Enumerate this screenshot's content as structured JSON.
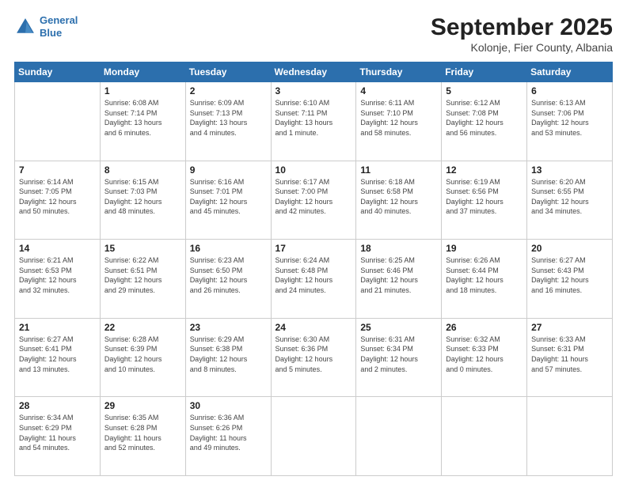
{
  "header": {
    "logo_line1": "General",
    "logo_line2": "Blue",
    "title": "September 2025",
    "subtitle": "Kolonje, Fier County, Albania"
  },
  "days_of_week": [
    "Sunday",
    "Monday",
    "Tuesday",
    "Wednesday",
    "Thursday",
    "Friday",
    "Saturday"
  ],
  "weeks": [
    [
      {
        "num": "",
        "info": ""
      },
      {
        "num": "1",
        "info": "Sunrise: 6:08 AM\nSunset: 7:14 PM\nDaylight: 13 hours\nand 6 minutes."
      },
      {
        "num": "2",
        "info": "Sunrise: 6:09 AM\nSunset: 7:13 PM\nDaylight: 13 hours\nand 4 minutes."
      },
      {
        "num": "3",
        "info": "Sunrise: 6:10 AM\nSunset: 7:11 PM\nDaylight: 13 hours\nand 1 minute."
      },
      {
        "num": "4",
        "info": "Sunrise: 6:11 AM\nSunset: 7:10 PM\nDaylight: 12 hours\nand 58 minutes."
      },
      {
        "num": "5",
        "info": "Sunrise: 6:12 AM\nSunset: 7:08 PM\nDaylight: 12 hours\nand 56 minutes."
      },
      {
        "num": "6",
        "info": "Sunrise: 6:13 AM\nSunset: 7:06 PM\nDaylight: 12 hours\nand 53 minutes."
      }
    ],
    [
      {
        "num": "7",
        "info": "Sunrise: 6:14 AM\nSunset: 7:05 PM\nDaylight: 12 hours\nand 50 minutes."
      },
      {
        "num": "8",
        "info": "Sunrise: 6:15 AM\nSunset: 7:03 PM\nDaylight: 12 hours\nand 48 minutes."
      },
      {
        "num": "9",
        "info": "Sunrise: 6:16 AM\nSunset: 7:01 PM\nDaylight: 12 hours\nand 45 minutes."
      },
      {
        "num": "10",
        "info": "Sunrise: 6:17 AM\nSunset: 7:00 PM\nDaylight: 12 hours\nand 42 minutes."
      },
      {
        "num": "11",
        "info": "Sunrise: 6:18 AM\nSunset: 6:58 PM\nDaylight: 12 hours\nand 40 minutes."
      },
      {
        "num": "12",
        "info": "Sunrise: 6:19 AM\nSunset: 6:56 PM\nDaylight: 12 hours\nand 37 minutes."
      },
      {
        "num": "13",
        "info": "Sunrise: 6:20 AM\nSunset: 6:55 PM\nDaylight: 12 hours\nand 34 minutes."
      }
    ],
    [
      {
        "num": "14",
        "info": "Sunrise: 6:21 AM\nSunset: 6:53 PM\nDaylight: 12 hours\nand 32 minutes."
      },
      {
        "num": "15",
        "info": "Sunrise: 6:22 AM\nSunset: 6:51 PM\nDaylight: 12 hours\nand 29 minutes."
      },
      {
        "num": "16",
        "info": "Sunrise: 6:23 AM\nSunset: 6:50 PM\nDaylight: 12 hours\nand 26 minutes."
      },
      {
        "num": "17",
        "info": "Sunrise: 6:24 AM\nSunset: 6:48 PM\nDaylight: 12 hours\nand 24 minutes."
      },
      {
        "num": "18",
        "info": "Sunrise: 6:25 AM\nSunset: 6:46 PM\nDaylight: 12 hours\nand 21 minutes."
      },
      {
        "num": "19",
        "info": "Sunrise: 6:26 AM\nSunset: 6:44 PM\nDaylight: 12 hours\nand 18 minutes."
      },
      {
        "num": "20",
        "info": "Sunrise: 6:27 AM\nSunset: 6:43 PM\nDaylight: 12 hours\nand 16 minutes."
      }
    ],
    [
      {
        "num": "21",
        "info": "Sunrise: 6:27 AM\nSunset: 6:41 PM\nDaylight: 12 hours\nand 13 minutes."
      },
      {
        "num": "22",
        "info": "Sunrise: 6:28 AM\nSunset: 6:39 PM\nDaylight: 12 hours\nand 10 minutes."
      },
      {
        "num": "23",
        "info": "Sunrise: 6:29 AM\nSunset: 6:38 PM\nDaylight: 12 hours\nand 8 minutes."
      },
      {
        "num": "24",
        "info": "Sunrise: 6:30 AM\nSunset: 6:36 PM\nDaylight: 12 hours\nand 5 minutes."
      },
      {
        "num": "25",
        "info": "Sunrise: 6:31 AM\nSunset: 6:34 PM\nDaylight: 12 hours\nand 2 minutes."
      },
      {
        "num": "26",
        "info": "Sunrise: 6:32 AM\nSunset: 6:33 PM\nDaylight: 12 hours\nand 0 minutes."
      },
      {
        "num": "27",
        "info": "Sunrise: 6:33 AM\nSunset: 6:31 PM\nDaylight: 11 hours\nand 57 minutes."
      }
    ],
    [
      {
        "num": "28",
        "info": "Sunrise: 6:34 AM\nSunset: 6:29 PM\nDaylight: 11 hours\nand 54 minutes."
      },
      {
        "num": "29",
        "info": "Sunrise: 6:35 AM\nSunset: 6:28 PM\nDaylight: 11 hours\nand 52 minutes."
      },
      {
        "num": "30",
        "info": "Sunrise: 6:36 AM\nSunset: 6:26 PM\nDaylight: 11 hours\nand 49 minutes."
      },
      {
        "num": "",
        "info": ""
      },
      {
        "num": "",
        "info": ""
      },
      {
        "num": "",
        "info": ""
      },
      {
        "num": "",
        "info": ""
      }
    ]
  ]
}
